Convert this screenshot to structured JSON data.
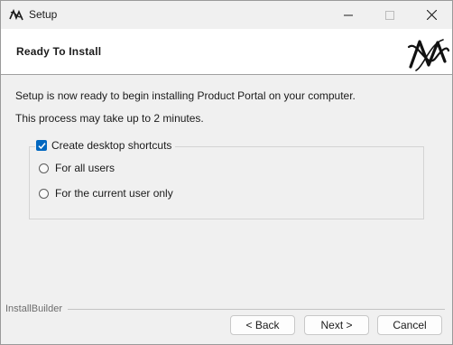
{
  "window": {
    "title": "Setup",
    "icons": {
      "app": "installbuilder-logo-icon",
      "minimize": "minimize-icon",
      "maximize": "maximize-icon",
      "close": "close-icon"
    }
  },
  "header": {
    "title": "Ready To Install",
    "logo": "installbuilder-logo"
  },
  "body": {
    "line1": "Setup is now ready to begin installing Product Portal on your computer.",
    "line2": "This process may take up to 2 minutes."
  },
  "shortcuts": {
    "checkbox_label": "Create desktop shortcuts",
    "checked": true,
    "options": [
      {
        "label": "For all users",
        "selected": false
      },
      {
        "label": "For the current user only",
        "selected": false
      }
    ]
  },
  "footer": {
    "brand": "InstallBuilder",
    "back_label": "< Back",
    "next_label": "Next >",
    "cancel_label": "Cancel"
  },
  "colors": {
    "accent": "#0067c0",
    "header_bg": "#ffffff",
    "window_bg": "#f0f0f0"
  }
}
